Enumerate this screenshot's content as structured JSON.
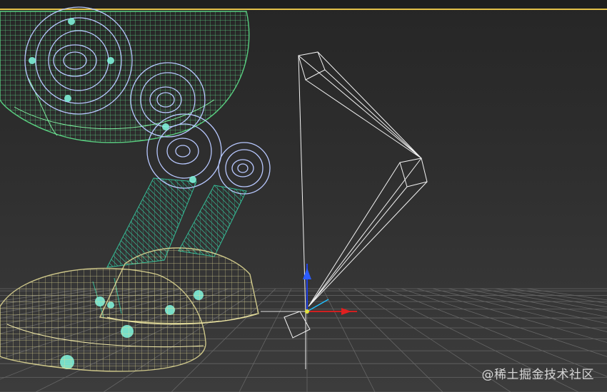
{
  "viewport": {
    "background_top": "#262626",
    "background_bottom": "#3c3c3c",
    "active_border_color": "#e4c24a"
  },
  "scene": {
    "colors": {
      "body_mesh": "#5fe08a",
      "joint_mesh": "#b8c8ff",
      "leg_mesh": "#37d4a8",
      "foot_mesh": "#e8e098",
      "bone_mesh": "#ffffff",
      "grid_line": "#6a6a6a",
      "x_axis": "#e02020",
      "y_axis": "#2090ff",
      "z_axis": "#2040e0",
      "helper_point": "#7ff0d8"
    },
    "icons": [
      "transform-gizmo-icon",
      "bone-chain-icon"
    ]
  },
  "watermark": {
    "text": "@稀土掘金技术社区"
  }
}
